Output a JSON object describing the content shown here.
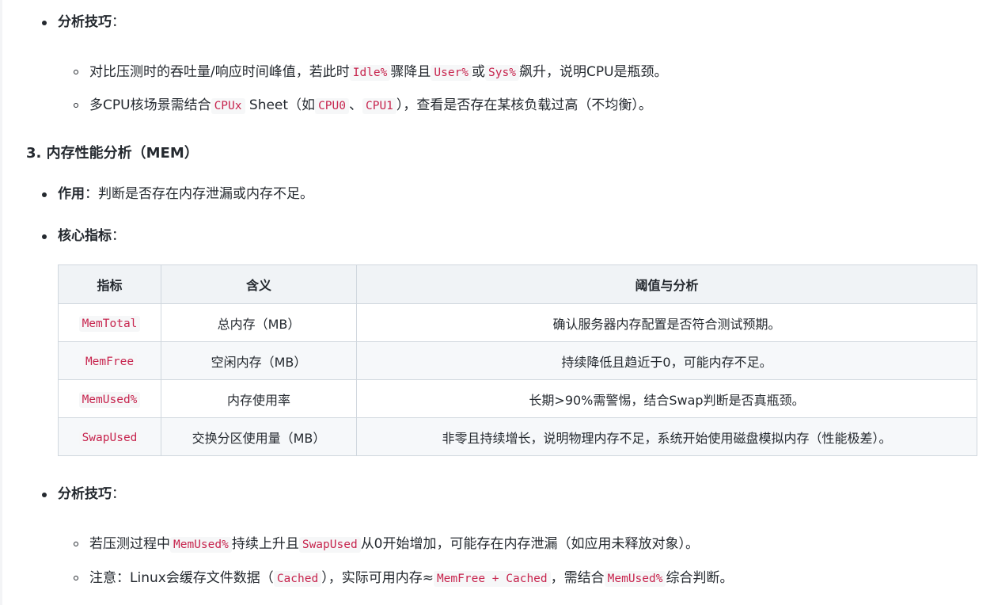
{
  "top_tips": {
    "title": "分析技巧",
    "colon": "：",
    "items": [
      {
        "p1": "对比压测时的吞吐量/响应时间峰值，若此时",
        "c1": "Idle%",
        "p2": "骤降且",
        "c2": "User%",
        "p3": "或",
        "c3": "Sys%",
        "p4": "飙升，说明CPU是瓶颈。"
      },
      {
        "p1": "多CPU核场景需结合",
        "c1": "CPUx",
        "p2": "Sheet（如",
        "c2": "CPU0",
        "p3": "、",
        "c3": "CPU1",
        "p4": "），查看是否存在某核负载过高（不均衡）。"
      }
    ]
  },
  "section": {
    "heading": "3. 内存性能分析（MEM）",
    "purpose_label": "作用",
    "purpose_text": "：判断是否存在内存泄漏或内存不足。",
    "metrics_label": "核心指标",
    "metrics_colon": "："
  },
  "table": {
    "headers": [
      "指标",
      "含义",
      "阈值与分析"
    ],
    "rows": [
      {
        "metric": "MemTotal",
        "meaning": "总内存（MB）",
        "analysis": "确认服务器内存配置是否符合测试预期。"
      },
      {
        "metric": "MemFree",
        "meaning": "空闲内存（MB）",
        "analysis": "持续降低且趋近于0，可能内存不足。"
      },
      {
        "metric": "MemUsed%",
        "meaning": "内存使用率",
        "analysis": "长期>90%需警惕，结合Swap判断是否真瓶颈。"
      },
      {
        "metric": "SwapUsed",
        "meaning": "交换分区使用量（MB）",
        "analysis": "非零且持续增长，说明物理内存不足，系统开始使用磁盘模拟内存（性能极差）。"
      }
    ]
  },
  "bottom_tips": {
    "title": "分析技巧",
    "colon": "：",
    "item1": {
      "p1": "若压测过程中",
      "c1": "MemUsed%",
      "p2": "持续上升且",
      "c2": "SwapUsed",
      "p3": "从0开始增加，可能存在内存泄漏（如应用未释放对象）。"
    },
    "item2": {
      "p1": "注意：Linux会缓存文件数据（",
      "c1": "Cached",
      "p2": "），实际可用内存≈",
      "c2": "MemFree + Cached",
      "p3": "，需结合",
      "c3": "MemUsed%",
      "p4": "综合判断。"
    }
  }
}
